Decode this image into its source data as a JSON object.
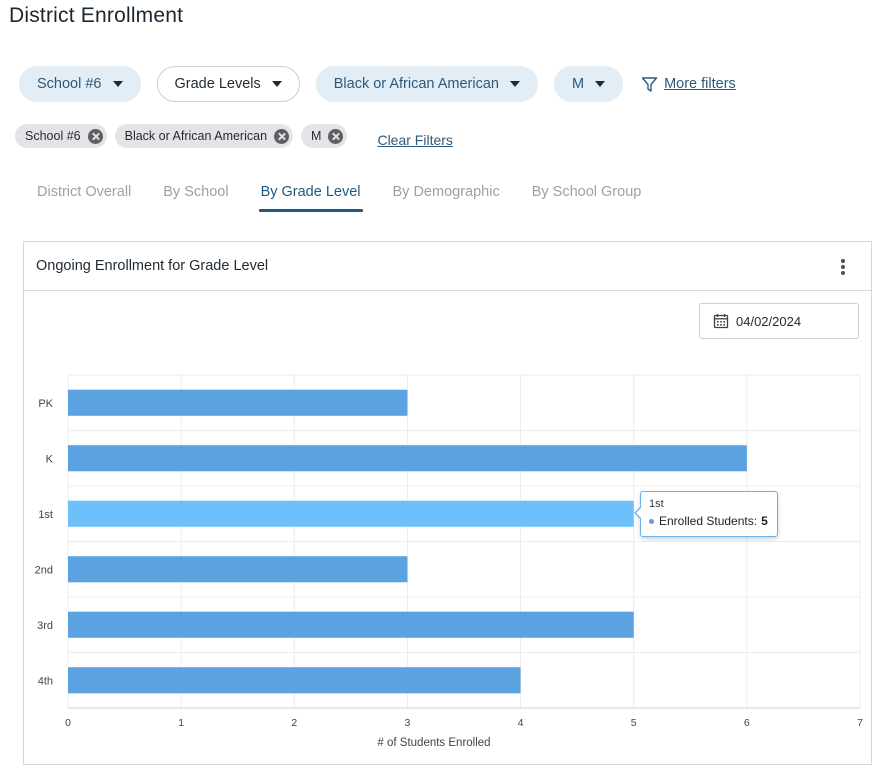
{
  "page": {
    "title": "District Enrollment"
  },
  "filters": {
    "school": "School #6",
    "grade_levels": "Grade Levels",
    "race": "Black or African American",
    "gender": "M",
    "more_filters": "More filters"
  },
  "active_chips": [
    "School #6",
    "Black or African American",
    "M"
  ],
  "clear_filters": "Clear Filters",
  "tabs": [
    {
      "label": "District Overall",
      "active": false
    },
    {
      "label": "By School",
      "active": false
    },
    {
      "label": "By Grade Level",
      "active": true
    },
    {
      "label": "By Demographic",
      "active": false
    },
    {
      "label": "By School Group",
      "active": false
    }
  ],
  "card": {
    "title": "Ongoing Enrollment for Grade Level",
    "date": "04/02/2024"
  },
  "colors": {
    "bar": "#5ba3e0",
    "bar_highlight": "#6ec0fb",
    "accent": "#1f5a84"
  },
  "tooltip": {
    "category": "1st",
    "label": "Enrolled Students:",
    "value": "5"
  },
  "chart_data": {
    "type": "bar",
    "orientation": "horizontal",
    "categories": [
      "PK",
      "K",
      "1st",
      "2nd",
      "3rd",
      "4th"
    ],
    "values": [
      3,
      6,
      5,
      3,
      5,
      4
    ],
    "highlighted_category": "1st",
    "xlabel": "# of Students Enrolled",
    "ylabel": "",
    "xlim": [
      0,
      7
    ],
    "xticks": [
      "0",
      "1",
      "2",
      "3",
      "4",
      "5",
      "6",
      "7"
    ],
    "grid": true
  }
}
